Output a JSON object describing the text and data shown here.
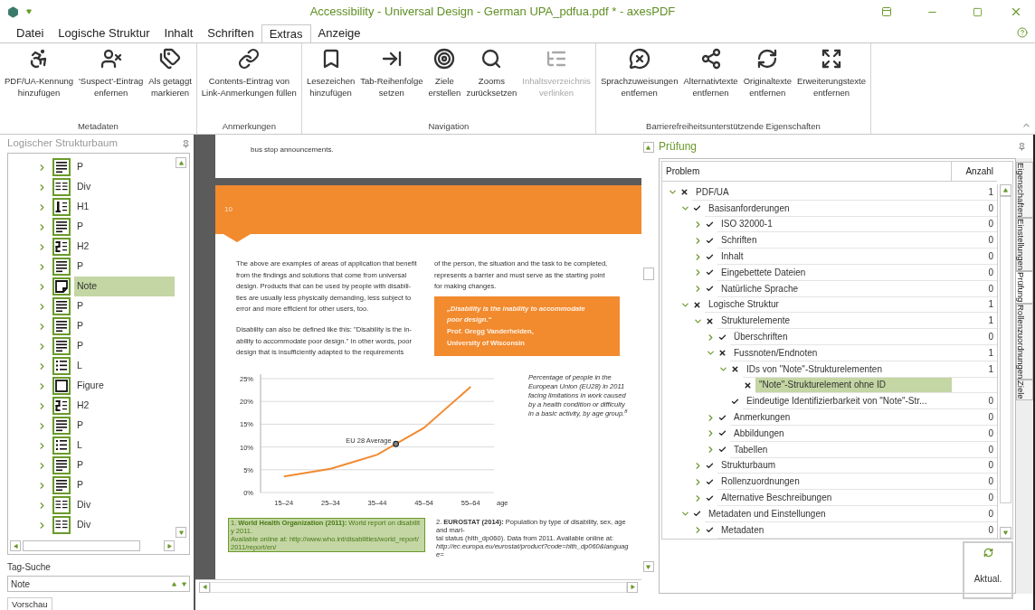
{
  "window": {
    "title": "Accessibility - Universal Design - German UPA_pdfua.pdf * - axesPDF"
  },
  "menu_tabs": [
    {
      "label": "Datei",
      "selected": false
    },
    {
      "label": "Logische Struktur",
      "selected": false
    },
    {
      "label": "Inhalt",
      "selected": false
    },
    {
      "label": "Schriften",
      "selected": false
    },
    {
      "label": "Extras",
      "selected": true
    },
    {
      "label": "Anzeige",
      "selected": false
    }
  ],
  "ribbon": [
    {
      "label": "Metadaten",
      "buttons": [
        {
          "lines": [
            "PDF/UA-Kennung",
            "hinzufügen"
          ],
          "disabled": false
        },
        {
          "lines": [
            "'Suspect'-Eintrag",
            "enfernen"
          ],
          "disabled": false
        },
        {
          "lines": [
            "Als getaggt",
            "markieren"
          ],
          "disabled": false
        }
      ]
    },
    {
      "label": "Anmerkungen",
      "buttons": [
        {
          "lines": [
            "Contents-Eintrag von",
            "Link-Anmerkungen füllen"
          ],
          "disabled": false
        }
      ]
    },
    {
      "label": "Navigation",
      "buttons": [
        {
          "lines": [
            "Lesezeichen",
            "hinzufügen"
          ],
          "disabled": false
        },
        {
          "lines": [
            "Tab-Reihenfolge",
            "setzen"
          ],
          "disabled": false
        },
        {
          "lines": [
            "Ziele",
            "erstellen"
          ],
          "disabled": false
        },
        {
          "lines": [
            "Zooms",
            "zurücksetzen"
          ],
          "disabled": false
        },
        {
          "lines": [
            "Inhaltsverzeichnis",
            "verlinken"
          ],
          "disabled": true
        }
      ]
    },
    {
      "label": "Barrierefreiheitsunterstützende Eigenschaften",
      "buttons": [
        {
          "lines": [
            "Sprachzuweisungen",
            "entfernen"
          ],
          "disabled": false
        },
        {
          "lines": [
            "Alternativtexte",
            "entfernen"
          ],
          "disabled": false
        },
        {
          "lines": [
            "Originaltexte",
            "entfernen"
          ],
          "disabled": false
        },
        {
          "lines": [
            "Erweiterungstexte",
            "entfernen"
          ],
          "disabled": false
        }
      ]
    }
  ],
  "structure_panel": {
    "title": "Logischer Strukturbaum",
    "items": [
      {
        "tag": "P",
        "kind": "paragraph",
        "selected": false
      },
      {
        "tag": "Div",
        "kind": "division",
        "selected": false
      },
      {
        "tag": "H1",
        "kind": "heading1",
        "selected": false
      },
      {
        "tag": "P",
        "kind": "paragraph",
        "selected": false
      },
      {
        "tag": "H2",
        "kind": "heading2",
        "selected": false
      },
      {
        "tag": "P",
        "kind": "paragraph",
        "selected": false
      },
      {
        "tag": "Note",
        "kind": "note",
        "selected": true
      },
      {
        "tag": "P",
        "kind": "paragraph",
        "selected": false
      },
      {
        "tag": "P",
        "kind": "paragraph",
        "selected": false
      },
      {
        "tag": "P",
        "kind": "paragraph",
        "selected": false
      },
      {
        "tag": "L",
        "kind": "list",
        "selected": false
      },
      {
        "tag": "Figure",
        "kind": "figure",
        "selected": false
      },
      {
        "tag": "H2",
        "kind": "heading2",
        "selected": false
      },
      {
        "tag": "P",
        "kind": "paragraph",
        "selected": false
      },
      {
        "tag": "L",
        "kind": "list",
        "selected": false
      },
      {
        "tag": "P",
        "kind": "paragraph",
        "selected": false
      },
      {
        "tag": "P",
        "kind": "paragraph",
        "selected": false
      },
      {
        "tag": "Div",
        "kind": "division",
        "selected": false
      },
      {
        "tag": "Div",
        "kind": "division",
        "selected": false
      }
    ],
    "tag_search": {
      "label": "Tag-Suche",
      "value": "Note"
    },
    "bottom_tab": "Vorschau"
  },
  "document": {
    "top_line": "bus stop announcements.",
    "page_number": "10",
    "left_paragraphs": [
      {
        "lines": [
          "The above are examples of areas of application that benefit",
          "from the findings and solutions that come from universal",
          "design. Products that can be used by people with disabili-",
          "ties are usually less physically demanding, less subject to",
          "error and more efficient for other users, too."
        ]
      },
      {
        "lines": [
          "Disability can also be defined like this: \"Disability is the in-",
          "ability to accommodate poor design.\" In other words, poor",
          "design that is insufficiently adapted to the requirements"
        ]
      }
    ],
    "right_paragraph": {
      "lines": [
        "of the person, the situation and the task to be completed,",
        "represents a barrier and must serve as the starting point",
        "for making changes."
      ]
    },
    "quote": {
      "quote_lines": [
        "„Disability is the inability to accommodate",
        "poor design.“"
      ],
      "author_lines": [
        "Prof. Gregg Vanderheiden,",
        "University of Wisconsin"
      ]
    },
    "chart_data": {
      "type": "line",
      "xlabel": "age",
      "grid": true,
      "categories": [
        "15–24",
        "25–34",
        "35–44",
        "45–54",
        "55–64"
      ],
      "series": [
        {
          "color": "#f28a30",
          "values": [
            3.5,
            5.2,
            8.3,
            14.2,
            23.2
          ]
        }
      ],
      "ylim": [
        0,
        25
      ],
      "yticks": [
        {
          "value": 0,
          "label": "0%"
        },
        {
          "value": 5,
          "label": "5%"
        },
        {
          "value": 10,
          "label": "10%"
        },
        {
          "value": 15,
          "label": "15%"
        },
        {
          "value": 20,
          "label": "20%"
        },
        {
          "value": 25,
          "label": "25%"
        }
      ],
      "annotations": [
        "EU 28 Average"
      ]
    },
    "caption_lines": [
      "Percentage of people in the",
      "European Union (EU28) in 2011",
      "facing limitations in work caused",
      "by a health condition or difficulty",
      "in a basic activity, by age group.$^{8}$"
    ],
    "footnotes": [
      {
        "lines": [
          "1. **World Health Organization (2011):** World report on disability 2011.",
          "Available online at: http://www.who.int/disabilities/world_report/",
          "2011/report/en/"
        ],
        "highlighted": true
      },
      {
        "lines": [
          "2. **EUROSTAT (2014):** Population by type of disability, sex, age and mari-",
          "tal status (hlth_dp060). Data from 2011. Available online at:",
          "*http://ec.europa.eu/eurostat/product?code=hlth_dp060&language=*"
        ],
        "highlighted": false
      }
    ]
  },
  "check_panel": {
    "title": "Prüfung",
    "columns": [
      "Problem",
      "Anzahl"
    ],
    "rows": [
      {
        "label": "PDF/UA",
        "passed": false,
        "count": "1",
        "expandable": true,
        "expanded": true,
        "selected": false,
        "children": [
          {
            "label": "Basisanforderungen",
            "passed": true,
            "count": "0",
            "expandable": true,
            "expanded": true,
            "selected": false,
            "children": [
              {
                "label": "ISO 32000-1",
                "passed": true,
                "count": "0",
                "expandable": true,
                "expanded": false,
                "selected": false
              },
              {
                "label": "Schriften",
                "passed": true,
                "count": "0",
                "expandable": true,
                "expanded": false,
                "selected": false
              },
              {
                "label": "Inhalt",
                "passed": true,
                "count": "0",
                "expandable": true,
                "expanded": false,
                "selected": false
              },
              {
                "label": "Eingebettete Dateien",
                "passed": true,
                "count": "0",
                "expandable": true,
                "expanded": false,
                "selected": false
              },
              {
                "label": "Natürliche Sprache",
                "passed": true,
                "count": "0",
                "expandable": true,
                "expanded": false,
                "selected": false
              }
            ]
          },
          {
            "label": "Logische Struktur",
            "passed": false,
            "count": "1",
            "expandable": true,
            "expanded": true,
            "selected": false,
            "children": [
              {
                "label": "Strukturelemente",
                "passed": false,
                "count": "1",
                "expandable": true,
                "expanded": true,
                "selected": false,
                "children": [
                  {
                    "label": "Überschriften",
                    "passed": true,
                    "count": "0",
                    "expandable": true,
                    "expanded": false,
                    "selected": false
                  },
                  {
                    "label": "Fussnoten/Endnoten",
                    "passed": false,
                    "count": "1",
                    "expandable": true,
                    "expanded": true,
                    "selected": false,
                    "children": [
                      {
                        "label": "IDs von \"Note\"-Strukturelementen",
                        "passed": false,
                        "count": "1",
                        "expandable": true,
                        "expanded": true,
                        "selected": false,
                        "children": [
                          {
                            "label": "\"Note\"-Strukturelement ohne ID",
                            "passed": false,
                            "expandable": false,
                            "selected": true
                          }
                        ]
                      },
                      {
                        "label": "Eindeutige Identifizierbarkeit von \"Note\"-Str...",
                        "passed": true,
                        "count": "0",
                        "expandable": false,
                        "selected": false
                      }
                    ]
                  },
                  {
                    "label": "Anmerkungen",
                    "passed": true,
                    "count": "0",
                    "expandable": true,
                    "expanded": false,
                    "selected": false
                  },
                  {
                    "label": "Abbildungen",
                    "passed": true,
                    "count": "0",
                    "expandable": true,
                    "expanded": false,
                    "selected": false
                  },
                  {
                    "label": "Tabellen",
                    "passed": true,
                    "count": "0",
                    "expandable": true,
                    "expanded": false,
                    "selected": false
                  }
                ]
              },
              {
                "label": "Strukturbaum",
                "passed": true,
                "count": "0",
                "expandable": true,
                "expanded": false,
                "selected": false
              },
              {
                "label": "Rollenzuordnungen",
                "passed": true,
                "count": "0",
                "expandable": true,
                "expanded": false,
                "selected": false
              },
              {
                "label": "Alternative Beschreibungen",
                "passed": true,
                "count": "0",
                "expandable": true,
                "expanded": false,
                "selected": false
              }
            ]
          },
          {
            "label": "Metadaten und Einstellungen",
            "passed": true,
            "count": "0",
            "expandable": true,
            "expanded": true,
            "selected": false,
            "children": [
              {
                "label": "Metadaten",
                "passed": true,
                "count": "0",
                "expandable": true,
                "expanded": false,
                "selected": false
              }
            ]
          }
        ]
      }
    ],
    "refresh_button": "Aktual.",
    "side_tabs": [
      {
        "label": "Eigenschaften",
        "selected": false
      },
      {
        "label": "Einstellungen",
        "selected": false
      },
      {
        "label": "Prüfung",
        "selected": true
      },
      {
        "label": "Rollenzuordnungen",
        "selected": false
      },
      {
        "label": "Ziele",
        "selected": false
      }
    ]
  }
}
